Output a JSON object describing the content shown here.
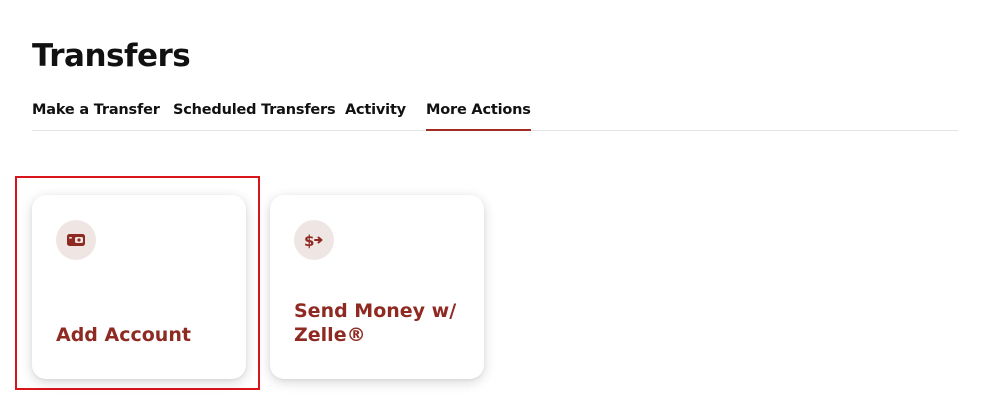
{
  "page": {
    "title": "Transfers"
  },
  "tabs": [
    {
      "label": "Make a Transfer",
      "active": false
    },
    {
      "label": "Scheduled Transfers",
      "active": false
    },
    {
      "label": "Activity",
      "active": false
    },
    {
      "label": "More Actions",
      "active": true
    }
  ],
  "cards": [
    {
      "label": "Add Account",
      "icon": "wallet-icon",
      "highlighted": true
    },
    {
      "label": "Send Money w/ Zelle®",
      "icon": "dollar-send-icon",
      "highlighted": false
    }
  ],
  "colors": {
    "accent": "#a22c24",
    "card_label": "#8f2a22",
    "icon_bg": "#efe6e4",
    "highlight": "#d8151b"
  }
}
